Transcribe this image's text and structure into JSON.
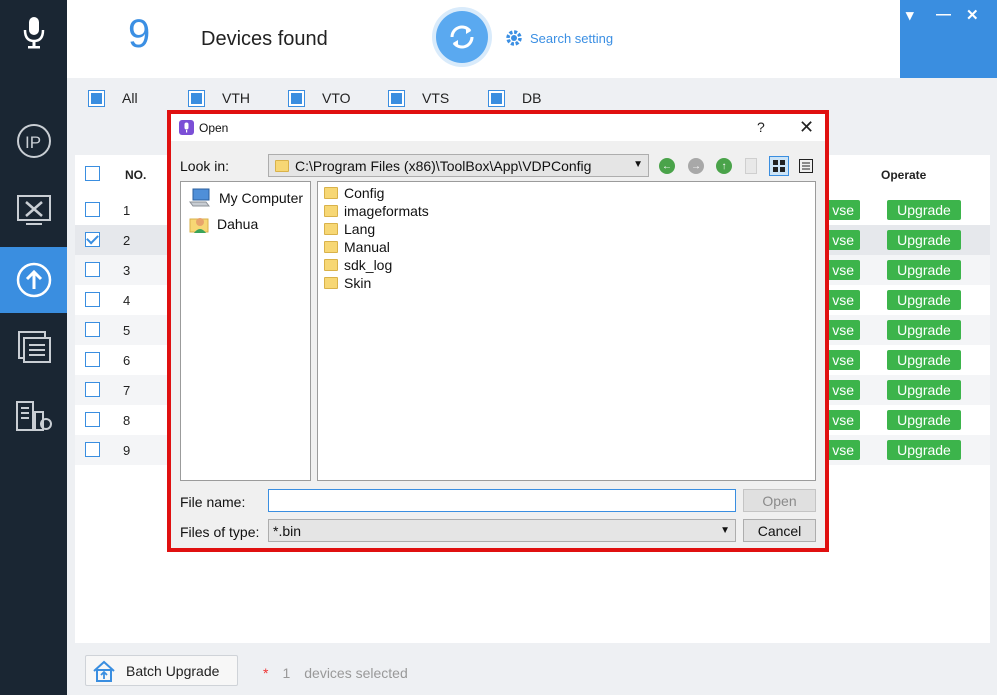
{
  "header": {
    "device_count": "9",
    "devices_found_label": "Devices found",
    "search_setting_label": "Search setting"
  },
  "filters": [
    {
      "label": "All"
    },
    {
      "label": "VTH"
    },
    {
      "label": "VTO"
    },
    {
      "label": "VTS"
    },
    {
      "label": "DB"
    }
  ],
  "table": {
    "col_no": "NO.",
    "col_operate": "Operate",
    "browse_label_partial": "vse",
    "upgrade_label": "Upgrade",
    "rows": [
      {
        "no": "1",
        "checked": false
      },
      {
        "no": "2",
        "checked": true
      },
      {
        "no": "3",
        "checked": false
      },
      {
        "no": "4",
        "checked": false
      },
      {
        "no": "5",
        "checked": false
      },
      {
        "no": "6",
        "checked": false
      },
      {
        "no": "7",
        "checked": false
      },
      {
        "no": "8",
        "checked": false
      },
      {
        "no": "9",
        "checked": false
      }
    ]
  },
  "footer": {
    "batch_upgrade_label": "Batch Upgrade",
    "star": "*",
    "selected_count": "1",
    "selected_suffix": "devices selected"
  },
  "dialog": {
    "title": "Open",
    "help": "?",
    "close": "✕",
    "look_in_label": "Look in:",
    "look_in_path": "C:\\Program Files (x86)\\ToolBox\\App\\VDPConfig",
    "places": [
      {
        "label": "My Computer"
      },
      {
        "label": "Dahua"
      }
    ],
    "files": [
      {
        "name": "Config"
      },
      {
        "name": "imageformats"
      },
      {
        "name": "Lang"
      },
      {
        "name": "Manual"
      },
      {
        "name": "sdk_log"
      },
      {
        "name": "Skin"
      }
    ],
    "file_name_label": "File name:",
    "file_name_value": "",
    "open_label": "Open",
    "file_type_label": "Files of type:",
    "file_type_value": "*.bin",
    "cancel_label": "Cancel"
  },
  "colors": {
    "accent": "#3a8ee0",
    "sidebar": "#1a2633",
    "upgrade_green": "#3cb44b",
    "highlight_red": "#e01010"
  }
}
